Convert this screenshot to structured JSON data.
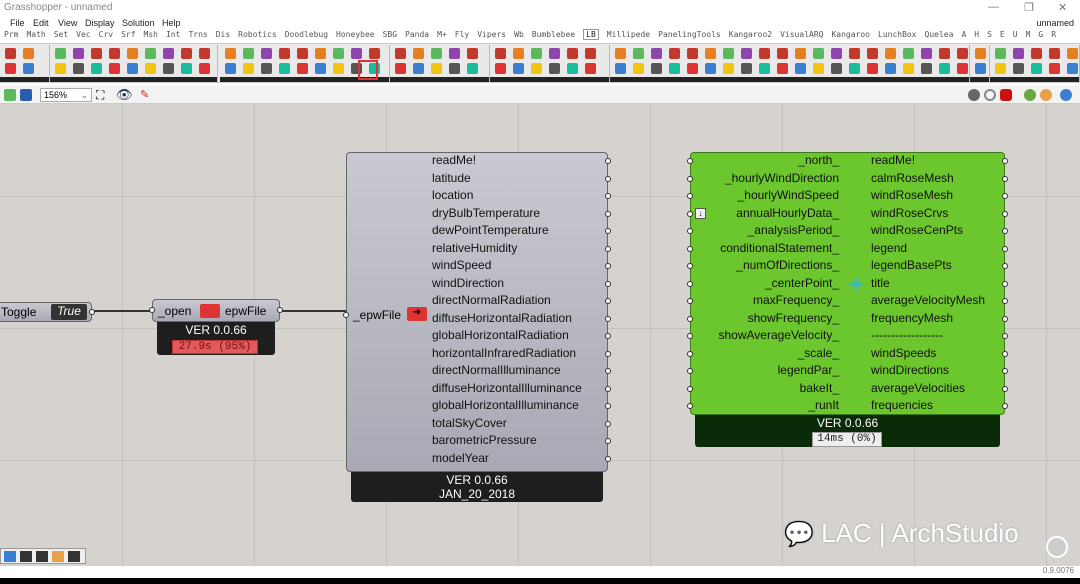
{
  "window": {
    "title": "Grasshopper - unnamed",
    "doc_name": "unnamed",
    "controls": [
      "—",
      "❐",
      "✕"
    ]
  },
  "menu": [
    "File",
    "Edit",
    "View",
    "Display",
    "Solution",
    "Help"
  ],
  "tabs": [
    "Prm",
    "Math",
    "Set",
    "Vec",
    "Crv",
    "Srf",
    "Msh",
    "Int",
    "Trns",
    "Dis",
    "Robotics",
    "Doodlebug",
    "Honeybee",
    "SBG",
    "Panda",
    "M+",
    "Fly",
    "Vipers",
    "Wb",
    "Bumblebee",
    "LB",
    "Millipede",
    "PanelingTools",
    "Kangaroo2",
    "VisualARQ",
    "Kangaroo",
    "LunchBox",
    "Quelea",
    "A",
    "H",
    "S",
    "E",
    "U",
    "M",
    "G",
    "R"
  ],
  "active_tab": "LB",
  "toolbar": {
    "zoom": "156%"
  },
  "toggle": {
    "label": "Toggle",
    "value": "True"
  },
  "open_epw": {
    "input": "_open",
    "output": "epwFile",
    "version": "VER 0.0.66",
    "runtime": "27.9s (95%)"
  },
  "import_epw": {
    "input": "_epwFile",
    "outputs": [
      "readMe!",
      "latitude",
      "location",
      "dryBulbTemperature",
      "dewPointTemperature",
      "relativeHumidity",
      "windSpeed",
      "windDirection",
      "directNormalRadiation",
      "diffuseHorizontalRadiation",
      "globalHorizontalRadiation",
      "horizontalInfraredRadiation",
      "directNormalIlluminance",
      "diffuseHorizontalIlluminance",
      "globalHorizontalIlluminance",
      "totalSkyCover",
      "barometricPressure",
      "modelYear"
    ],
    "version": "VER 0.0.66",
    "date": "JAN_20_2018"
  },
  "wind_rose": {
    "inputs": [
      "_north_",
      "_hourlyWindDirection",
      "_hourlyWindSpeed",
      "annualHourlyData_",
      "_analysisPeriod_",
      "conditionalStatement_",
      "_numOfDirections_",
      "_centerPoint_",
      "maxFrequency_",
      "showFrequency_",
      "showAverageVelocity_",
      "_scale_",
      "legendPar_",
      "bakeIt_",
      "_runIt"
    ],
    "outputs": [
      "readMe!",
      "calmRoseMesh",
      "windRoseMesh",
      "windRoseCrvs",
      "windRoseCenPts",
      "legend",
      "legendBasePts",
      "title",
      "averageVelocityMesh",
      "frequencyMesh",
      "------------------",
      "windSpeeds",
      "windDirections",
      "averageVelocities",
      "frequencies"
    ],
    "version": "VER 0.0.66",
    "runtime": "14ms (0%)"
  },
  "watermark": "LAC | ArchStudio",
  "status": {
    "version": "0.9.0076"
  },
  "colors": {
    "green": "#6cc72e",
    "badge_red": "#e45a5a",
    "canvas": "#d6d3ce"
  }
}
